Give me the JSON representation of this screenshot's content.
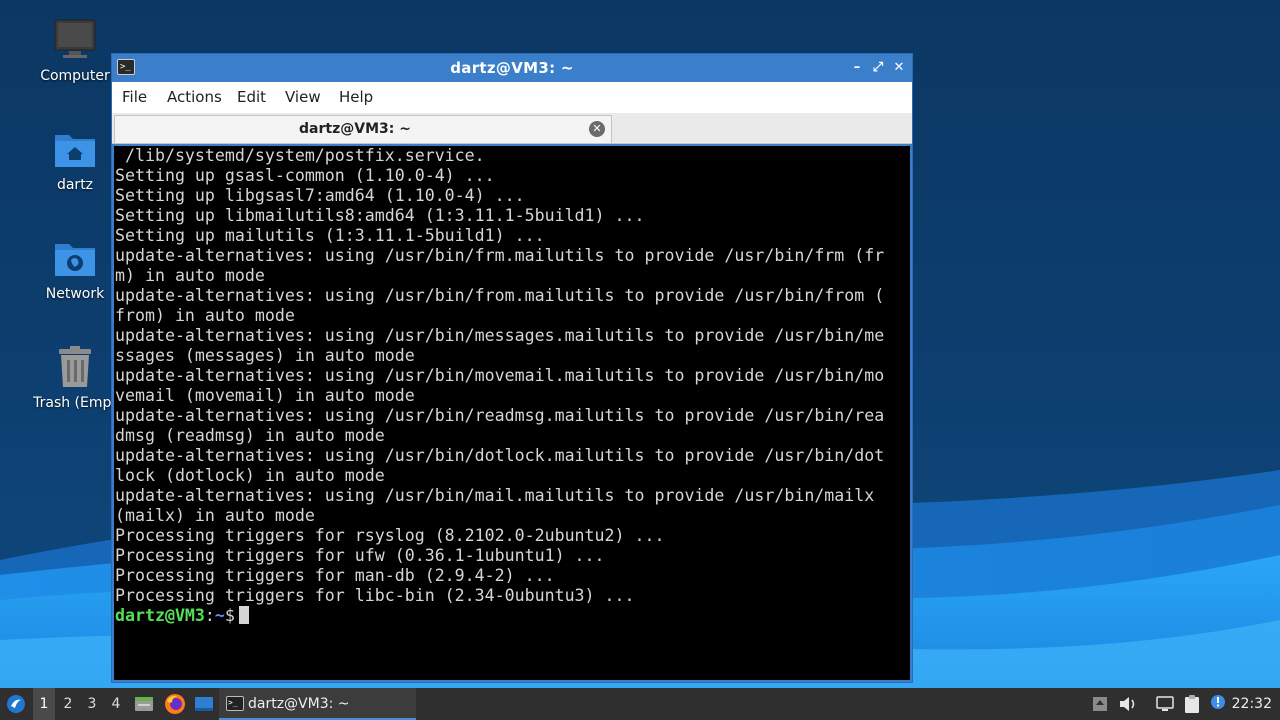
{
  "desktop": {
    "icons": [
      {
        "label": "Computer",
        "icon": "computer-icon"
      },
      {
        "label": "dartz",
        "icon": "home-folder-icon"
      },
      {
        "label": "Network",
        "icon": "network-folder-icon"
      },
      {
        "label": "Trash (Empt",
        "icon": "trash-icon"
      }
    ]
  },
  "window": {
    "title": "dartz@VM3: ~",
    "controls": {
      "minimize": "–",
      "maximize": "⤢",
      "close": "✕"
    },
    "menu": [
      "File",
      "Actions",
      "Edit",
      "View",
      "Help"
    ],
    "tab": {
      "title": "dartz@VM3: ~",
      "close": "✕"
    }
  },
  "terminal": {
    "lines": [
      " /lib/systemd/system/postfix.service.",
      "Setting up gsasl-common (1.10.0-4) ...",
      "Setting up libgsasl7:amd64 (1.10.0-4) ...",
      "Setting up libmailutils8:amd64 (1:3.11.1-5build1) ...",
      "Setting up mailutils (1:3.11.1-5build1) ...",
      "update-alternatives: using /usr/bin/frm.mailutils to provide /usr/bin/frm (fr",
      "m) in auto mode",
      "update-alternatives: using /usr/bin/from.mailutils to provide /usr/bin/from (",
      "from) in auto mode",
      "update-alternatives: using /usr/bin/messages.mailutils to provide /usr/bin/me",
      "ssages (messages) in auto mode",
      "update-alternatives: using /usr/bin/movemail.mailutils to provide /usr/bin/mo",
      "vemail (movemail) in auto mode",
      "update-alternatives: using /usr/bin/readmsg.mailutils to provide /usr/bin/rea",
      "dmsg (readmsg) in auto mode",
      "update-alternatives: using /usr/bin/dotlock.mailutils to provide /usr/bin/dot",
      "lock (dotlock) in auto mode",
      "update-alternatives: using /usr/bin/mail.mailutils to provide /usr/bin/mailx",
      "(mailx) in auto mode",
      "Processing triggers for rsyslog (8.2102.0-2ubuntu2) ...",
      "Processing triggers for ufw (0.36.1-1ubuntu1) ...",
      "Processing triggers for man-db (2.9.4-2) ...",
      "Processing triggers for libc-bin (2.34-0ubuntu3) ..."
    ],
    "prompt": {
      "user_host": "dartz@VM3",
      "separator": ":",
      "path": "~",
      "symbol": "$"
    }
  },
  "taskbar": {
    "workspaces": [
      "1",
      "2",
      "3",
      "4"
    ],
    "active_workspace": "1",
    "task": {
      "label": "dartz@VM3: ~",
      "icon": "terminal-icon"
    },
    "clock": "22:32"
  },
  "colors": {
    "titlebar": "#3b7fcb",
    "terminal_bg": "#000000",
    "terminal_fg": "#d6d6d6",
    "prompt_user": "#55e055",
    "prompt_path": "#5f8fff"
  }
}
